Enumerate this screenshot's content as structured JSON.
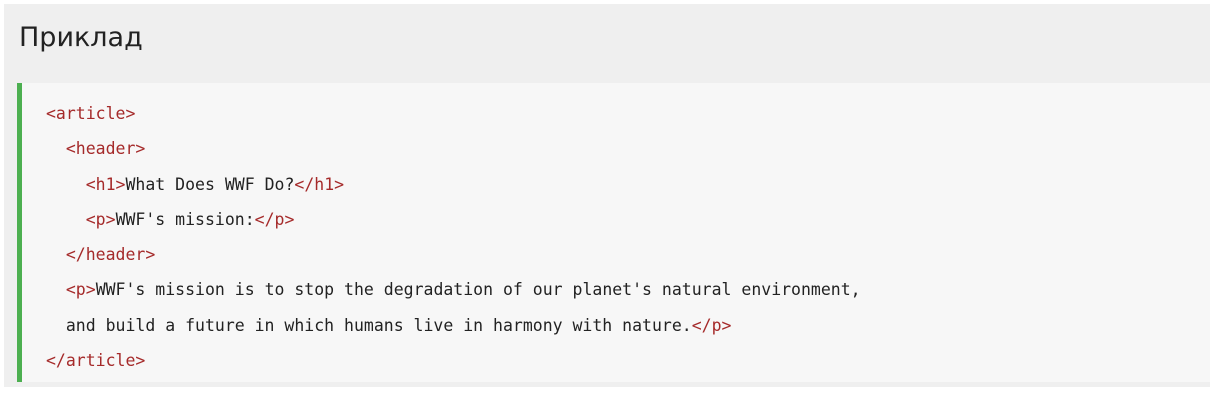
{
  "example": {
    "title": "Приклад",
    "code_lines": [
      {
        "indent": "",
        "parts": [
          {
            "text": "<article>",
            "tag": true
          }
        ]
      },
      {
        "indent": "  ",
        "parts": [
          {
            "text": "<header>",
            "tag": true
          }
        ]
      },
      {
        "indent": "    ",
        "parts": [
          {
            "text": "<h1>",
            "tag": true
          },
          {
            "text": "What Does WWF Do?",
            "tag": false
          },
          {
            "text": "</h1>",
            "tag": true
          }
        ]
      },
      {
        "indent": "    ",
        "parts": [
          {
            "text": "<p>",
            "tag": true
          },
          {
            "text": "WWF's mission:",
            "tag": false
          },
          {
            "text": "</p>",
            "tag": true
          }
        ]
      },
      {
        "indent": "  ",
        "parts": [
          {
            "text": "</header>",
            "tag": true
          }
        ]
      },
      {
        "indent": "  ",
        "parts": [
          {
            "text": "<p>",
            "tag": true
          },
          {
            "text": "WWF's mission is to stop the degradation of our planet's natural environment,",
            "tag": false
          }
        ]
      },
      {
        "indent": "  ",
        "parts": [
          {
            "text": "and build a future in which humans live in harmony with nature.",
            "tag": false
          },
          {
            "text": "</p>",
            "tag": true
          }
        ]
      },
      {
        "indent": "",
        "parts": [
          {
            "text": "</article>",
            "tag": true
          }
        ]
      }
    ]
  },
  "colors": {
    "box_background": "#efefef",
    "code_background": "#f7f7f7",
    "accent_border": "#4caf50",
    "tag": "#a52a2a",
    "text": "#222222"
  }
}
